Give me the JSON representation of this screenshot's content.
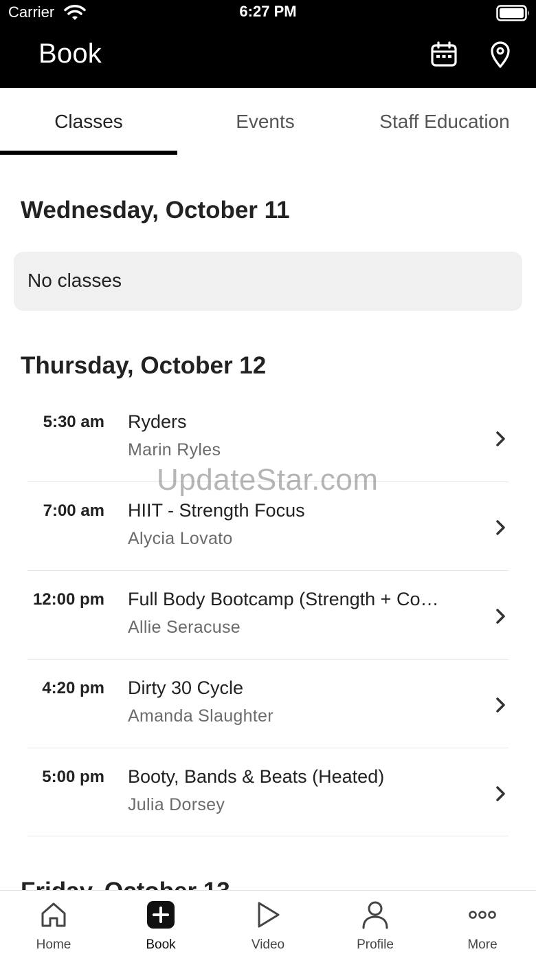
{
  "status_bar": {
    "carrier": "Carrier",
    "time": "6:27 PM"
  },
  "header": {
    "title": "Book",
    "icons": [
      "calendar-icon",
      "location-pin-icon"
    ]
  },
  "tabs": [
    {
      "label": "Classes",
      "active": true
    },
    {
      "label": "Events",
      "active": false
    },
    {
      "label": "Staff Education",
      "active": false
    }
  ],
  "days": [
    {
      "heading": "Wednesday, October 11",
      "empty_message": "No classes"
    },
    {
      "heading": "Thursday, October 12",
      "classes": [
        {
          "time": "5:30 am",
          "name": "Ryders",
          "instructor": "Marin Ryles"
        },
        {
          "time": "7:00 am",
          "name": "HIIT - Strength Focus",
          "instructor": "Alycia Lovato"
        },
        {
          "time": "12:00 pm",
          "name": "Full Body Bootcamp (Strength + Co…",
          "instructor": "Allie Seracuse"
        },
        {
          "time": "4:20 pm",
          "name": "Dirty 30 Cycle",
          "instructor": "Amanda Slaughter"
        },
        {
          "time": "5:00 pm",
          "name": "Booty, Bands & Beats (Heated)",
          "instructor": "Julia Dorsey"
        }
      ]
    },
    {
      "heading": "Friday, October 13"
    }
  ],
  "watermark": "UpdateStar.com",
  "bottom_nav": [
    {
      "label": "Home",
      "icon": "home-icon",
      "active": false
    },
    {
      "label": "Book",
      "icon": "plus-square-icon",
      "active": true
    },
    {
      "label": "Video",
      "icon": "play-icon",
      "active": false
    },
    {
      "label": "Profile",
      "icon": "person-icon",
      "active": false
    },
    {
      "label": "More",
      "icon": "more-dots-icon",
      "active": false
    }
  ],
  "colors": {
    "header_bg": "#000000",
    "active_indicator": "#000000",
    "card_bg": "#f0f0f0",
    "muted_text": "#6b6b6b"
  }
}
